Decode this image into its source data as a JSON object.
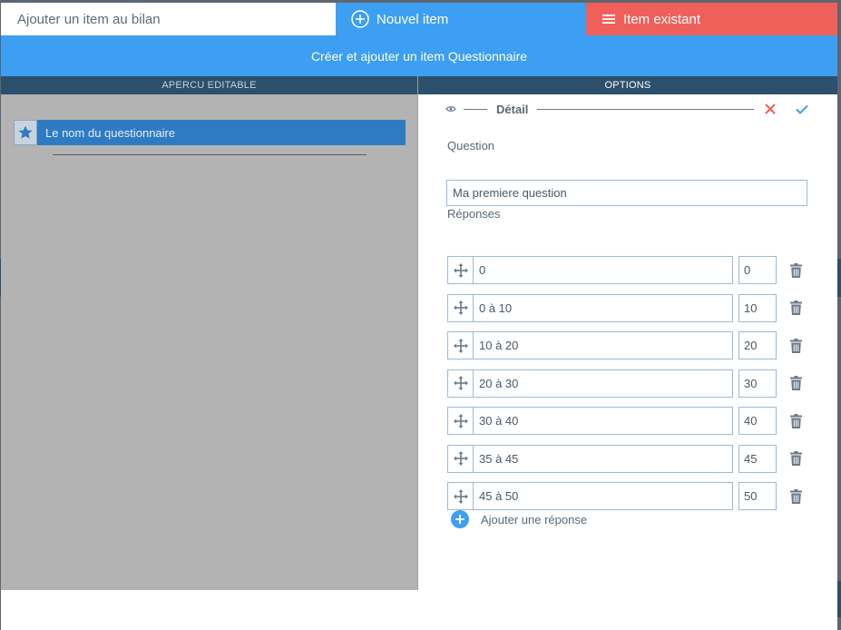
{
  "tabs": {
    "title": "Ajouter un item au bilan",
    "new_item": "Nouvel item",
    "existing_item": "Item existant"
  },
  "subheader": "Créer et ajouter un item Questionnaire",
  "preview": {
    "header": "APERCU EDITABLE",
    "questionnaire_name": "Le nom du questionnaire"
  },
  "options": {
    "header": "OPTIONS",
    "detail_label": "Détail",
    "question_label": "Question",
    "question_value": "Ma premiere question",
    "answers_label": "Réponses",
    "answers": [
      {
        "text": "0",
        "value": "0"
      },
      {
        "text": "0 à 10",
        "value": "10"
      },
      {
        "text": "10 à 20",
        "value": "20"
      },
      {
        "text": "20 à 30",
        "value": "30"
      },
      {
        "text": "30 à 40",
        "value": "40"
      },
      {
        "text": "35 à 45",
        "value": "45"
      },
      {
        "text": "45 à 50",
        "value": "50"
      }
    ],
    "add_answer": "Ajouter une réponse"
  },
  "colors": {
    "blue": "#3d9ff1",
    "red": "#f0605a",
    "dark": "#2c4f6c",
    "preview_bg": "#b3b3b3"
  },
  "icons": [
    "plus-circle-icon",
    "menu-icon",
    "star-icon",
    "eye-icon",
    "close-icon",
    "check-icon",
    "move-icon",
    "trash-icon"
  ]
}
